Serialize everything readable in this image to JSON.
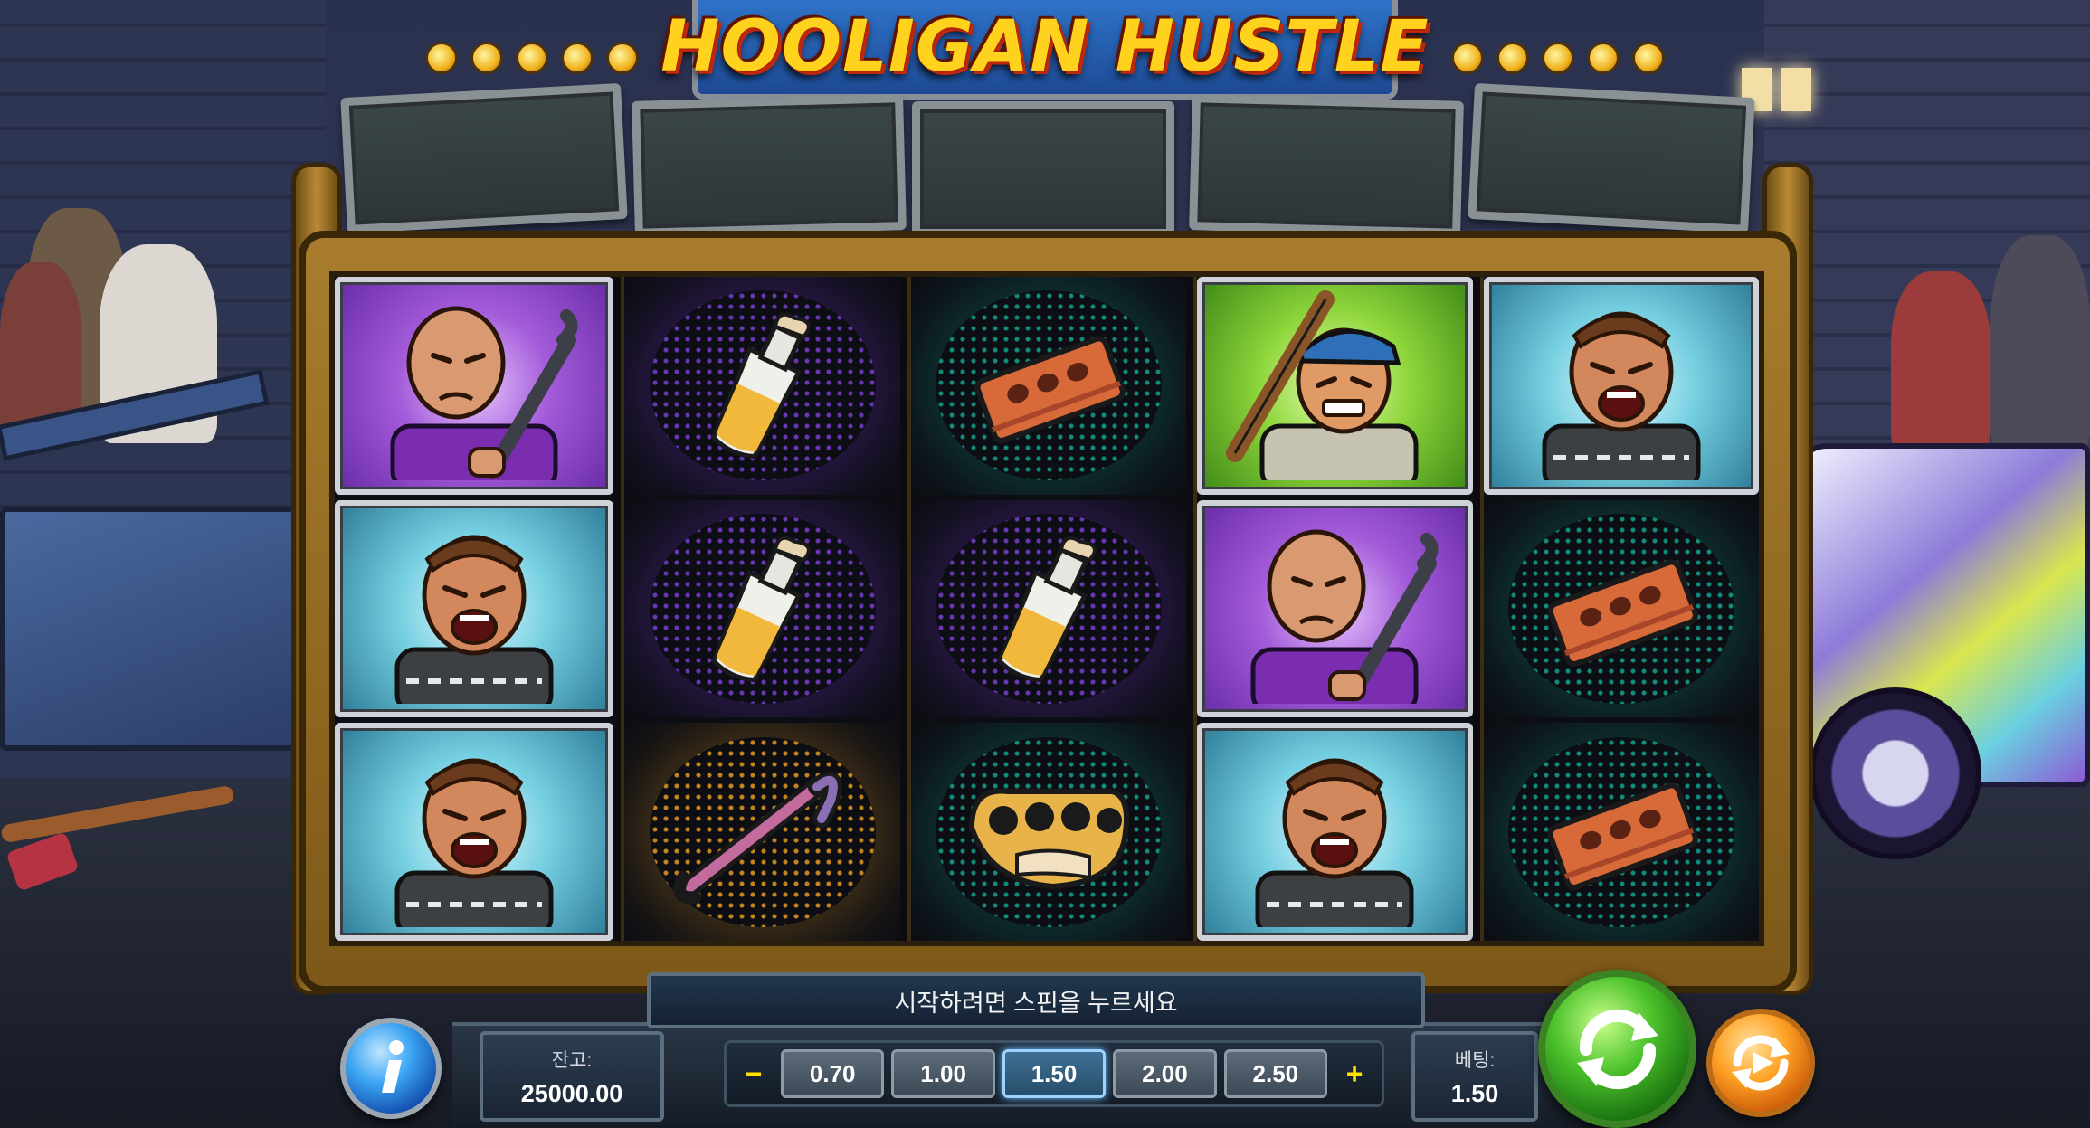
{
  "game": {
    "title": "HOOLIGAN HUSTLE"
  },
  "reels": [
    [
      "bald-hooligan-pipe",
      "screaming-fan",
      "screaming-fan"
    ],
    [
      "molotov-bottle",
      "molotov-bottle",
      "crowbar"
    ],
    [
      "brick",
      "molotov-bottle",
      "brass-knuckles"
    ],
    [
      "cap-hooligan-bat",
      "bald-hooligan-pipe",
      "screaming-fan"
    ],
    [
      "screaming-fan",
      "brick",
      "brick"
    ]
  ],
  "message": "시작하려면 스핀을 누르세요",
  "balance": {
    "label": "잔고:",
    "value": "25000.00"
  },
  "bet": {
    "label": "베팅:",
    "value": "1.50",
    "decrease": "−",
    "increase": "+",
    "options": [
      "0.70",
      "1.00",
      "1.50",
      "2.00",
      "2.50"
    ],
    "selected": "1.50"
  },
  "colors": {
    "frame": "#a87d2d",
    "title": "#ffd21d",
    "spin": "#4cc22b",
    "autoplay": "#ffa327",
    "info": "#3ba4f3"
  },
  "icons": {
    "info": "info-icon",
    "spin": "spin-arrows-icon",
    "autoplay": "autoplay-icon"
  }
}
